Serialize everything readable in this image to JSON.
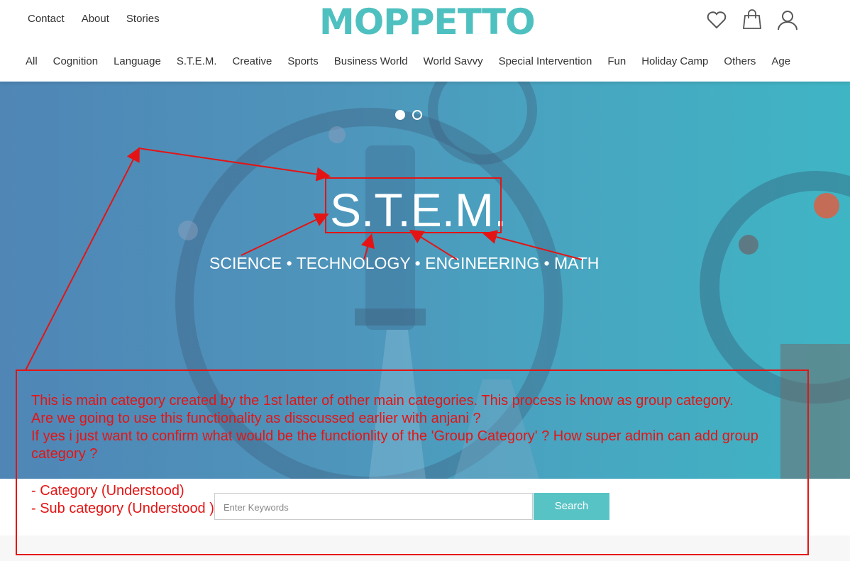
{
  "header": {
    "top_links": [
      "Contact",
      "About",
      "Stories"
    ],
    "logo": "MOPPETTO",
    "icons": [
      "heart-icon",
      "shopping-bag-icon",
      "user-icon"
    ]
  },
  "categories": [
    "All",
    "Cognition",
    "Language",
    "S.T.E.M.",
    "Creative",
    "Sports",
    "Business World",
    "World Savvy",
    "Special Intervention",
    "Fun",
    "Holiday Camp",
    "Others",
    "Age"
  ],
  "hero": {
    "title": "S.T.E.M.",
    "subtitle": "SCIENCE • TECHNOLOGY • ENGINEERING • MATH",
    "slides_total": 2,
    "slide_active": 1
  },
  "search": {
    "placeholder": "Enter Keywords",
    "button": "Search"
  },
  "annotation": {
    "color": "#e41414",
    "lines": [
      "This is main category created by the 1st latter of other main categories. This process is know as group category.",
      "Are we going to use this functionality as disscussed earlier with anjani ?",
      "If yes i just want to confirm what would be the functionlity of the 'Group Category' ? How super admin can add group category ?"
    ],
    "items": [
      "- Category (Understood)",
      "- Sub category (Understood )"
    ]
  },
  "colors": {
    "brand": "#4fc0c0",
    "button": "#58c3c5",
    "annotation": "#e41414"
  }
}
